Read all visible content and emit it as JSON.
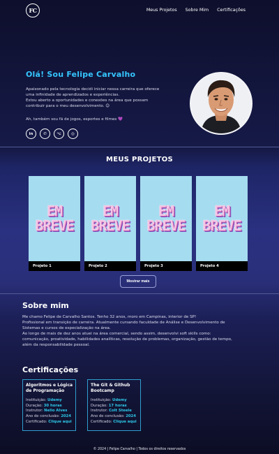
{
  "nav": {
    "logo": "FC",
    "links": [
      "Meus Projetos",
      "Sobre Mim",
      "Certificações"
    ]
  },
  "hero": {
    "greeting": "Olá! Sou Felipe Carvalho",
    "bio": [
      "Apaixonado pela tecnologia decidi iniciar nessa carreira que oferece",
      "uma infinidade de aprendizados e experiências.",
      "Estou aberto a oportunidades e conexões na área que possam",
      "contribuir para o meu desenvolvimento. 😊"
    ],
    "hobbies": "Ah, também sou fã de jogos, esportes e filmes 💜",
    "socials": [
      {
        "icon": "linkedin-icon",
        "glyph": "in"
      },
      {
        "icon": "whatsapp-icon",
        "glyph": "✆"
      },
      {
        "icon": "github-icon",
        "glyph": "⌥"
      },
      {
        "icon": "instagram-icon",
        "glyph": "◎"
      }
    ]
  },
  "projects": {
    "title": "MEUS PROJETOS",
    "placeholder_top": "EM",
    "placeholder_bottom": "BREVE",
    "items": [
      "Projeto 1",
      "Projeto 2",
      "Projeto 3",
      "Projeto 4"
    ],
    "more_button": "Mostrar mais"
  },
  "about": {
    "title": "Sobre mim",
    "lines": [
      "Me chamo Felipe de Carvalho Santos. Tenho 32 anos, moro em Campinas, interior de SP!",
      "Profissional em transição de carreira. Atualmente cursando faculdade de Análise e Desenvolvimento de",
      "Sistemas e cursos de especialização na área.",
      "Ao longo de mais de dez anos atuei na área comercial, sendo assim, desenvolvi soft skills como:",
      "comunicação, proatividade, habilidades analíticas, resolução de problemas, organização, gestão de tempo,",
      "além da responsabilidade pessoal."
    ]
  },
  "certs": {
    "title": "Certificações",
    "labels": {
      "institution": "Instituição:",
      "duration": "Duração:",
      "instructor": "Instrutor:",
      "year": "Ano de conclusão:",
      "certificate": "Certificado:"
    },
    "items": [
      {
        "title": "Algoritmos e Lógica de Programação",
        "institution": "Udemy",
        "duration": "30 horas",
        "instructor": "Nelio Alves",
        "year": "2024",
        "link": "Clique aqui"
      },
      {
        "title": "The Git & Github Bootcamp",
        "institution": "Udemy",
        "duration": "17 horas",
        "instructor": "Colt Steele",
        "year": "2024",
        "link": "Clique aqui"
      }
    ]
  },
  "footer": "© 2024 | Felipe Carvalho | Todos os direitos reservados",
  "colors": {
    "accent": "#35c6ff",
    "highlight": "#2ec8e8",
    "card_bg": "#a6dcf0"
  }
}
